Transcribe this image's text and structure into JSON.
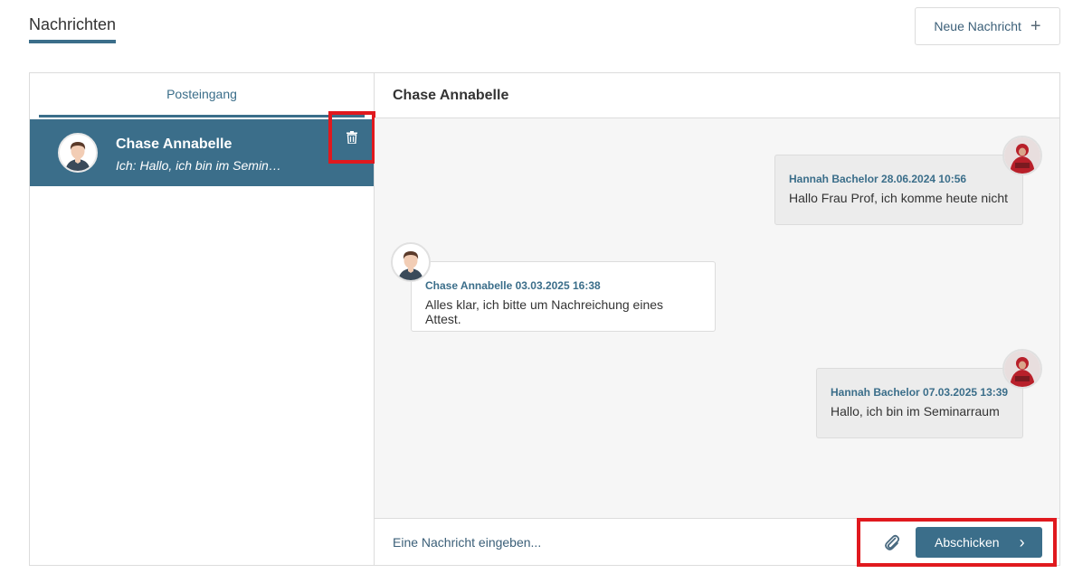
{
  "page": {
    "title": "Nachrichten"
  },
  "toolbar": {
    "new_message_label": "Neue Nachricht",
    "plus_icon": "+"
  },
  "inbox": {
    "tab_label": "Posteingang",
    "conversations": [
      {
        "name": "Chase Annabelle",
        "preview": "Ich: Hallo, ich bin im Semin…",
        "avatar": "male-avatar-icon"
      }
    ]
  },
  "chat": {
    "header_name": "Chase Annabelle",
    "messages": [
      {
        "direction": "sent",
        "sender": "Hannah Bachelor",
        "timestamp": "28.06.2024 10:56",
        "meta": "Hannah Bachelor 28.06.2024 10:56",
        "text": "Hallo Frau Prof, ich komme heute nicht",
        "avatar": "user-photo-avatar"
      },
      {
        "direction": "received",
        "sender": "Chase Annabelle",
        "timestamp": "03.03.2025 16:38",
        "meta": "Chase Annabelle 03.03.2025 16:38",
        "text": "Alles klar, ich bitte um Nachreichung eines Attest.",
        "avatar": "male-avatar-icon"
      },
      {
        "direction": "sent",
        "sender": "Hannah Bachelor",
        "timestamp": "07.03.2025 13:39",
        "meta": "Hannah Bachelor 07.03.2025 13:39",
        "text": "Hallo, ich bin im Seminarraum",
        "avatar": "user-photo-avatar"
      }
    ]
  },
  "compose": {
    "placeholder": "Eine Nachricht eingeben...",
    "send_label": "Abschicken",
    "send_chevron": "›"
  },
  "colors": {
    "accent": "#3b6e8a",
    "highlight_box": "#e0191e",
    "chat_bg": "#f6f6f6",
    "sent_bubble": "#ececec"
  }
}
